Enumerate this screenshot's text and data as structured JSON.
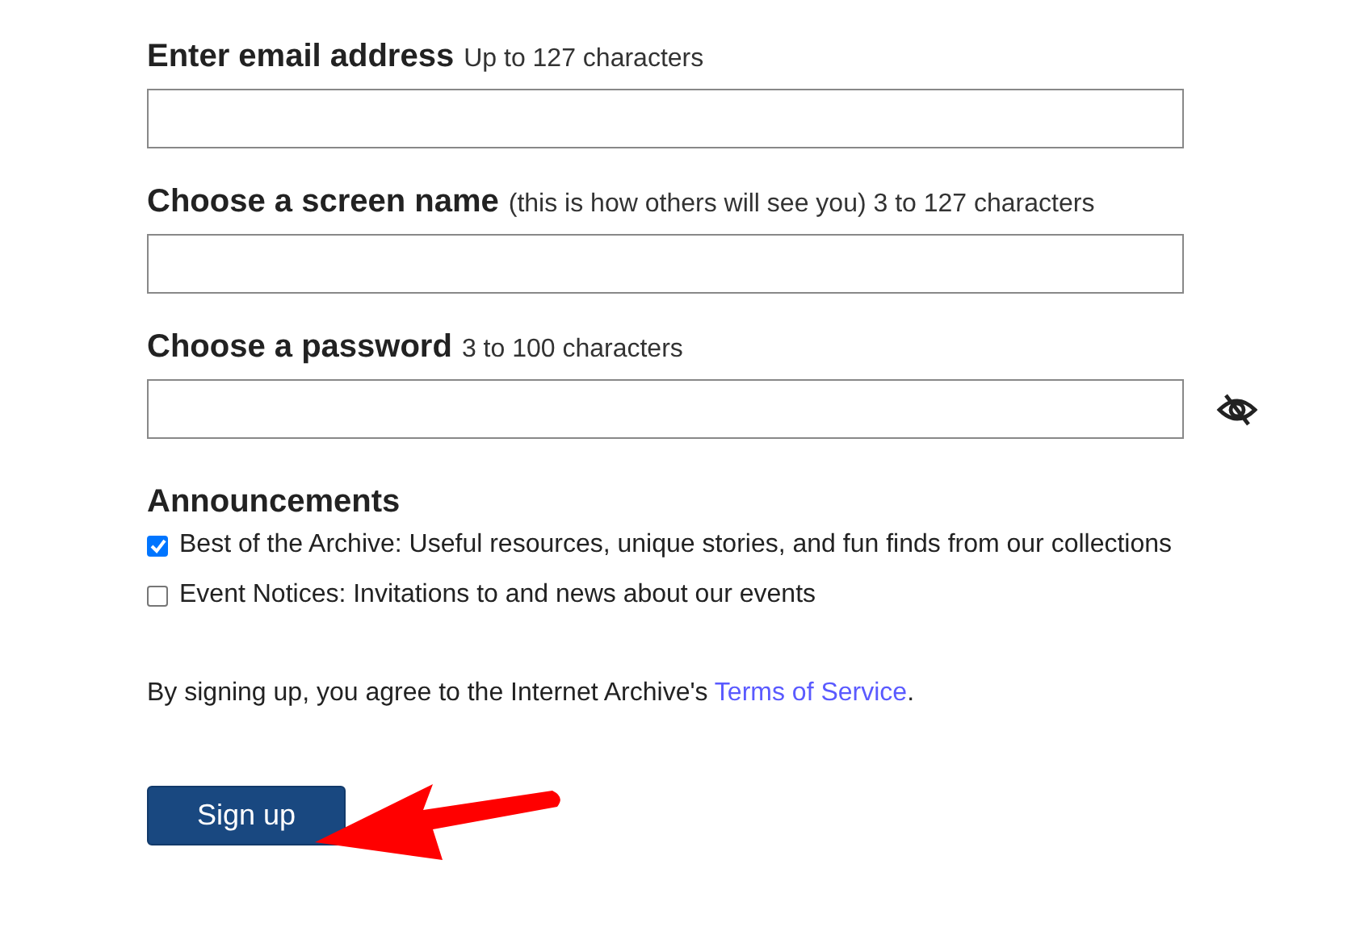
{
  "fields": [
    {
      "label": "Enter email address",
      "hint": "Up to 127 characters",
      "kind": "text"
    },
    {
      "label": "Choose a screen name",
      "hint": "(this is how others will see you) 3 to 127 characters",
      "kind": "text"
    },
    {
      "label": "Choose a password",
      "hint": "3 to 100 characters",
      "kind": "password"
    }
  ],
  "announcements": {
    "title": "Announcements",
    "options": [
      {
        "label": "Best of the Archive: Useful resources, unique stories, and fun finds from our collections",
        "checked": true
      },
      {
        "label": "Event Notices: Invitations to and news about our events",
        "checked": false
      }
    ]
  },
  "terms": {
    "text": "By signing up, you agree to the Internet Archive's ",
    "link": "Terms of Service",
    "after": "."
  },
  "submit": {
    "label": "Sign up"
  }
}
